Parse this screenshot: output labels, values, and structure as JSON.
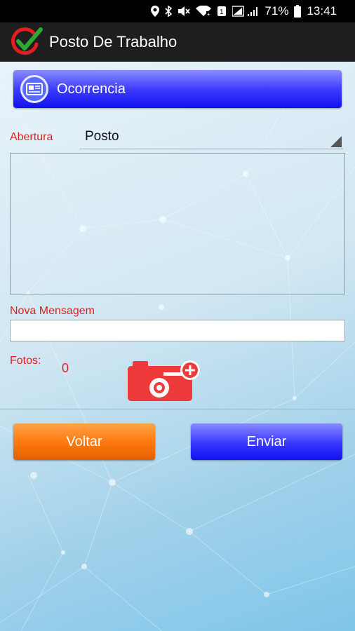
{
  "status_bar": {
    "battery": "71%",
    "time": "13:41",
    "icons": [
      "location-icon",
      "bluetooth-icon",
      "mute-icon",
      "wifi-icon",
      "signal-icon",
      "battery-icon"
    ]
  },
  "app_bar": {
    "title": "Posto De Trabalho",
    "logo": "checkmark-logo"
  },
  "form": {
    "ocorrencia_label": "Ocorrencia",
    "abertura_label": "Abertura",
    "abertura_selected": "Posto",
    "nova_mensagem_label": "Nova Mensagem",
    "nova_mensagem_value": "",
    "fotos_label": "Fotos:",
    "fotos_count": "0"
  },
  "actions": {
    "voltar_label": "Voltar",
    "enviar_label": "Enviar"
  },
  "colors": {
    "accent_blue": "#2020f5",
    "accent_orange": "#ff7a10",
    "label_red": "#e02020",
    "camera_red": "#ee3a3a"
  }
}
